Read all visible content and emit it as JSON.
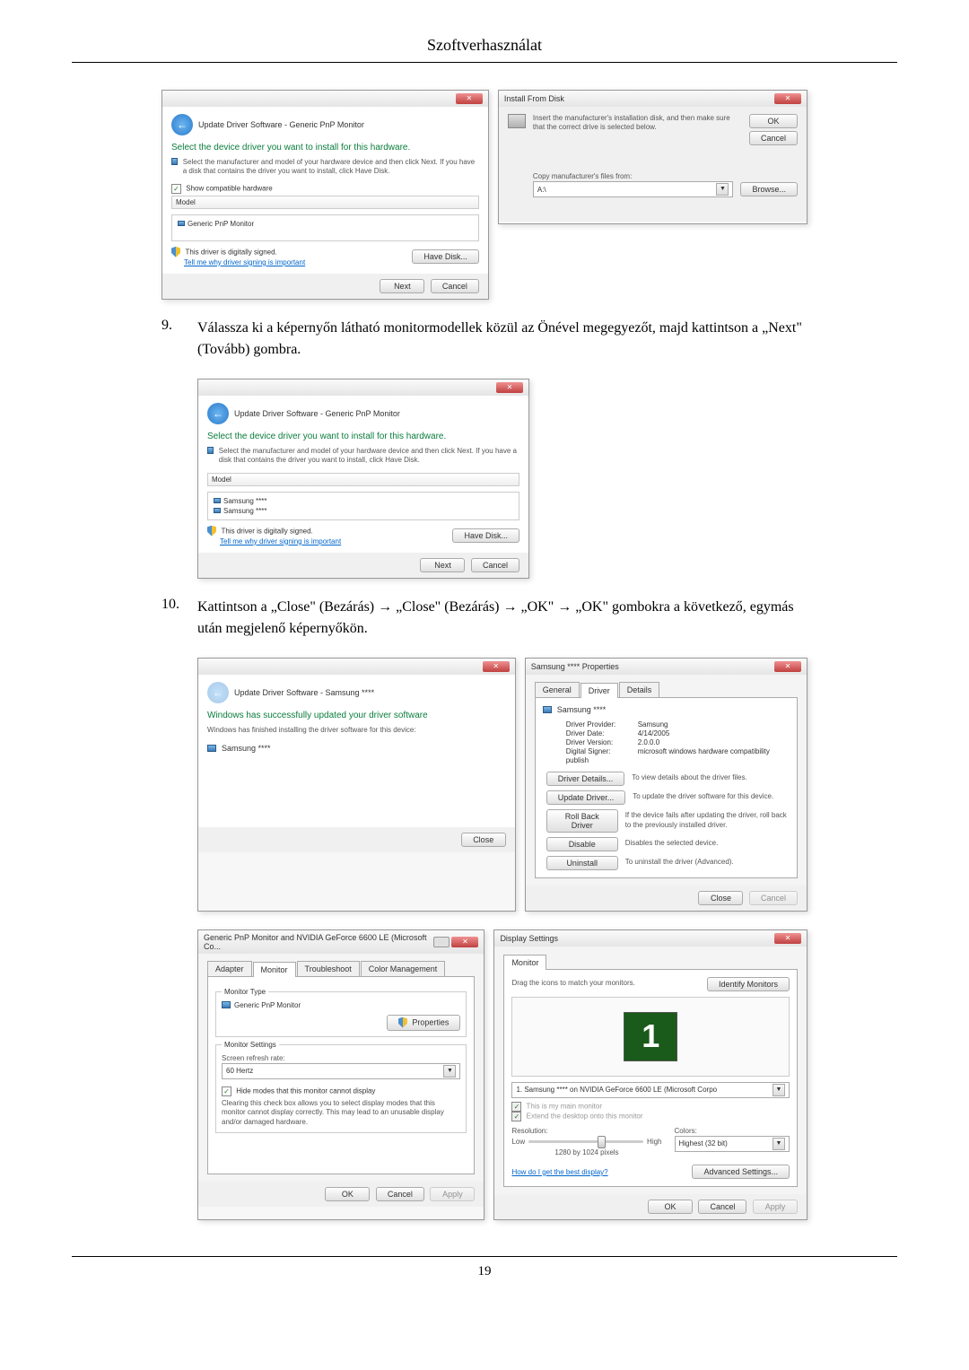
{
  "header": "Szoftverhasználat",
  "page_number": "19",
  "windows": {
    "update1": {
      "title": "Update Driver Software - Generic PnP Monitor",
      "heading": "Select the device driver you want to install for this hardware.",
      "desc": "Select the manufacturer and model of your hardware device and then click Next. If you have a disk that contains the driver you want to install, click Have Disk.",
      "show_compat": "Show compatible hardware",
      "model_header": "Model",
      "model_item": "Generic PnP Monitor",
      "signed": "This driver is digitally signed.",
      "signed_link": "Tell me why driver signing is important",
      "have_disk": "Have Disk...",
      "next": "Next",
      "cancel": "Cancel"
    },
    "install_disk": {
      "title": "Install From Disk",
      "desc": "Insert the manufacturer's installation disk, and then make sure that the correct drive is selected below.",
      "ok": "OK",
      "cancel": "Cancel",
      "copy_label": "Copy manufacturer's files from:",
      "drive": "A:\\",
      "browse": "Browse..."
    },
    "update2": {
      "title": "Update Driver Software - Generic PnP Monitor",
      "heading": "Select the device driver you want to install for this hardware.",
      "desc": "Select the manufacturer and model of your hardware device and then click Next. If you have a disk that contains the driver you want to install, click Have Disk.",
      "model_header": "Model",
      "model_item1": "Samsung ****",
      "model_item2": "Samsung ****",
      "signed": "This driver is digitally signed.",
      "signed_link": "Tell me why driver signing is important",
      "have_disk": "Have Disk...",
      "next": "Next",
      "cancel": "Cancel"
    },
    "update3": {
      "title": "Update Driver Software - Samsung ****",
      "heading": "Windows has successfully updated your driver software",
      "desc": "Windows has finished installing the driver software for this device:",
      "device": "Samsung ****",
      "close": "Close"
    },
    "properties": {
      "title": "Samsung **** Properties",
      "tabs": [
        "General",
        "Driver",
        "Details"
      ],
      "device_name": "Samsung ****",
      "provider_label": "Driver Provider:",
      "provider": "Samsung",
      "date_label": "Driver Date:",
      "date": "4/14/2005",
      "version_label": "Driver Version:",
      "version": "2.0.0.0",
      "signer_label": "Digital Signer:",
      "signer": "microsoft windows hardware compatibility publish",
      "btn_details": "Driver Details...",
      "txt_details": "To view details about the driver files.",
      "btn_update": "Update Driver...",
      "txt_update": "To update the driver software for this device.",
      "btn_rollback": "Roll Back Driver",
      "txt_rollback": "If the device fails after updating the driver, roll back to the previously installed driver.",
      "btn_disable": "Disable",
      "txt_disable": "Disables the selected device.",
      "btn_uninstall": "Uninstall",
      "txt_uninstall": "To uninstall the driver (Advanced).",
      "close": "Close",
      "cancel": "Cancel"
    },
    "adapter": {
      "title": "Generic PnP Monitor and NVIDIA GeForce 6600 LE (Microsoft Co...",
      "tabs": [
        "Adapter",
        "Monitor",
        "Troubleshoot",
        "Color Management"
      ],
      "type_label": "Monitor Type",
      "type": "Generic PnP Monitor",
      "btn_props": "Properties",
      "settings_label": "Monitor Settings",
      "refresh_label": "Screen refresh rate:",
      "refresh": "60 Hertz",
      "hide_label": "Hide modes that this monitor cannot display",
      "hide_desc": "Clearing this check box allows you to select display modes that this monitor cannot display correctly. This may lead to an unusable display and/or damaged hardware.",
      "ok": "OK",
      "cancel": "Cancel",
      "apply": "Apply"
    },
    "display": {
      "title": "Display Settings",
      "tab": "Monitor",
      "drag": "Drag the icons to match your monitors.",
      "identify": "Identify Monitors",
      "monitor_num": "1",
      "monitor_sel": "1. Samsung **** on NVIDIA GeForce 6600 LE (Microsoft Corpo",
      "main_label": "This is my main monitor",
      "extend_label": "Extend the desktop onto this monitor",
      "res_label": "Resolution:",
      "res_low": "Low",
      "res_high": "High",
      "res_val": "1280 by 1024 pixels",
      "colors_label": "Colors:",
      "colors_val": "Highest (32 bit)",
      "help_link": "How do I get the best display?",
      "advanced": "Advanced Settings...",
      "ok": "OK",
      "cancel": "Cancel",
      "apply": "Apply"
    }
  },
  "steps": {
    "s9_num": "9.",
    "s9_text": "Válassza ki a képernyőn látható monitormodellek közül az Önével megegyezőt, majd kattintson a „Next\" (Tovább) gombra.",
    "s10_num": "10.",
    "s10_text": "Kattintson a „Close\" (Bezárás) → „Close\" (Bezárás) → „OK\" → „OK\" gombokra a következő, egymás után megjelenő képernyőkön."
  }
}
